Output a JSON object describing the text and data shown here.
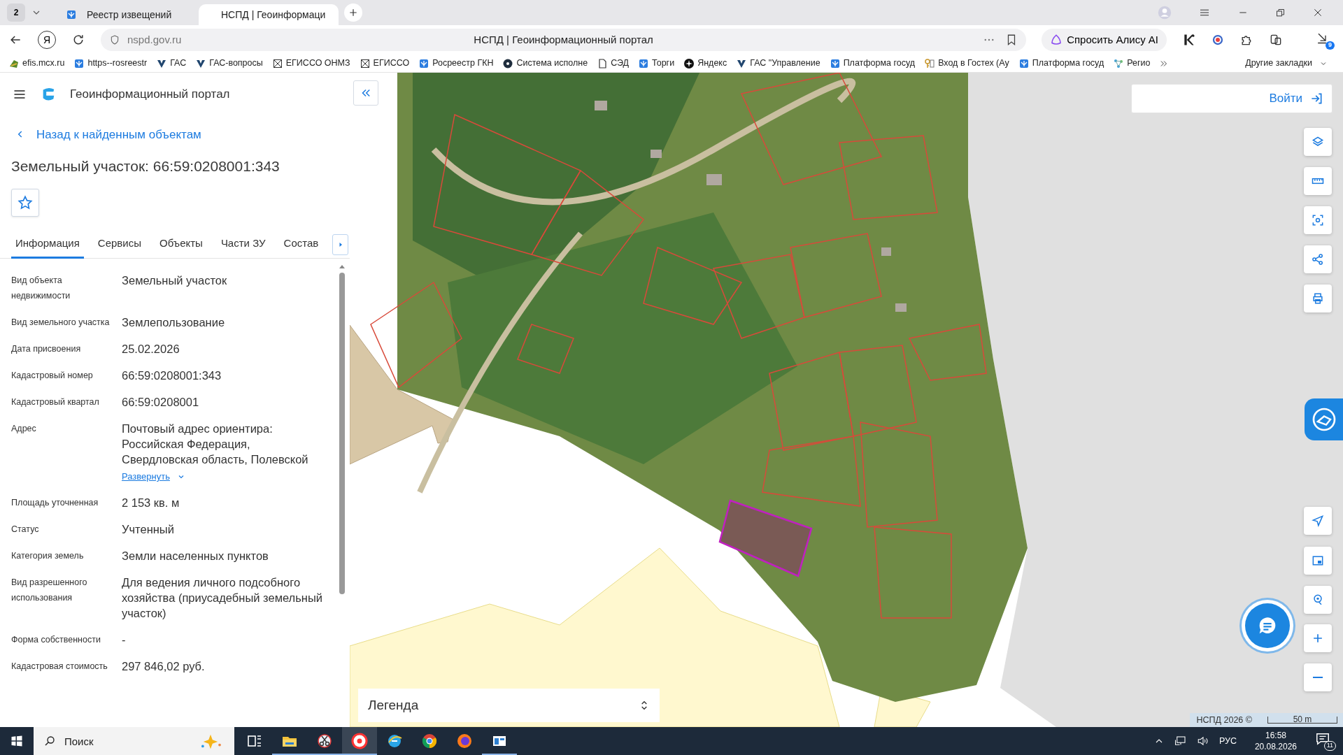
{
  "browser": {
    "tab_count": "2",
    "tabs": [
      {
        "title": "Реестр извещений",
        "selected": false,
        "kind": "eagle"
      },
      {
        "title": "НСПД | Геоинформаци",
        "selected": true,
        "kind": "nspd"
      }
    ],
    "yandex_button": "Я",
    "address": "nspd.gov.ru",
    "page_title": "НСПД | Геоинформационный портал",
    "alice": "Спросить Алису AI",
    "downloads_badge": "9",
    "bookmarks": [
      {
        "title": "efis.mcx.ru",
        "kind": "leaf"
      },
      {
        "title": "https--rosreestr",
        "kind": "eagle"
      },
      {
        "title": "ГАС",
        "kind": "shield"
      },
      {
        "title": "ГАС-вопросы",
        "kind": "shield"
      },
      {
        "title": "ЕГИССО  ОНМЗ",
        "kind": "box"
      },
      {
        "title": "ЕГИССО",
        "kind": "box"
      },
      {
        "title": "Росреестр ГКН",
        "kind": "eagle"
      },
      {
        "title": "Система исполне",
        "kind": "circle"
      },
      {
        "title": "СЭД",
        "kind": "doc"
      },
      {
        "title": "Торги",
        "kind": "eagle"
      },
      {
        "title": "Яндекс",
        "kind": "spark"
      },
      {
        "title": "ГАС \"Управление",
        "kind": "shield"
      },
      {
        "title": "Платформа госуд",
        "kind": "eagle"
      },
      {
        "title": "Вход в Гостех (Ау",
        "kind": "key"
      },
      {
        "title": "Платформа госуд",
        "kind": "eagle"
      },
      {
        "title": "Регио",
        "kind": "network"
      }
    ],
    "other_bookmarks": "Другие закладки"
  },
  "portal": {
    "title": "Геоинформационный портал",
    "back_link": "Назад к найденным объектам",
    "heading": "Земельный участок: 66:59:0208001:343",
    "favorite": false,
    "tabs": [
      {
        "label": "Информация",
        "selected": true
      },
      {
        "label": "Сервисы",
        "selected": false
      },
      {
        "label": "Объекты",
        "selected": false
      },
      {
        "label": "Части ЗУ",
        "selected": false
      },
      {
        "label": "Состав",
        "selected": false
      }
    ],
    "fields": [
      {
        "label": "Вид объекта недвижимости",
        "value": "Земельный участок"
      },
      {
        "label": "Вид земельного участка",
        "value": "Землепользование"
      },
      {
        "label": "Дата присвоения",
        "value": "25.02.2026"
      },
      {
        "label": "Кадастровый номер",
        "value": "66:59:0208001:343"
      },
      {
        "label": "Кадастровый квартал",
        "value": "66:59:0208001"
      },
      {
        "label": "Адрес",
        "value": "Почтовый адрес ориентира: Российская Федерация, Свердловская область, Полевской",
        "expand": "Развернуть"
      },
      {
        "label": "Площадь уточненная",
        "value": "2 153 кв. м"
      },
      {
        "label": "Статус",
        "value": "Учтенный"
      },
      {
        "label": "Категория земель",
        "value": "Земли населенных пунктов"
      },
      {
        "label": "Вид разрешенного использования",
        "value": "Для ведения личного подсобного хозяйства (приусадебный земельный участок)"
      },
      {
        "label": "Форма собственности",
        "value": "-"
      },
      {
        "label": "Кадастровая стоимость",
        "value": "297 846,02 руб."
      }
    ]
  },
  "map": {
    "login": "Войти",
    "legend": "Легенда",
    "attribution": "НСПД 2026 ©",
    "scale": "50 m"
  },
  "taskbar": {
    "search_placeholder": "Поиск",
    "apps": [
      {
        "kind": "task-view",
        "running": false,
        "selected": false
      },
      {
        "kind": "explorer",
        "running": true,
        "selected": false
      },
      {
        "kind": "snipping",
        "running": true,
        "selected": false
      },
      {
        "kind": "yandex",
        "running": true,
        "selected": true
      },
      {
        "kind": "ie",
        "running": false,
        "selected": false
      },
      {
        "kind": "chrome",
        "running": false,
        "selected": false
      },
      {
        "kind": "firefox",
        "running": false,
        "selected": false
      },
      {
        "kind": "window",
        "running": true,
        "selected": false
      }
    ],
    "language": "РУС",
    "time": "16:58",
    "date": "20.08.2026",
    "notifications": "11"
  }
}
